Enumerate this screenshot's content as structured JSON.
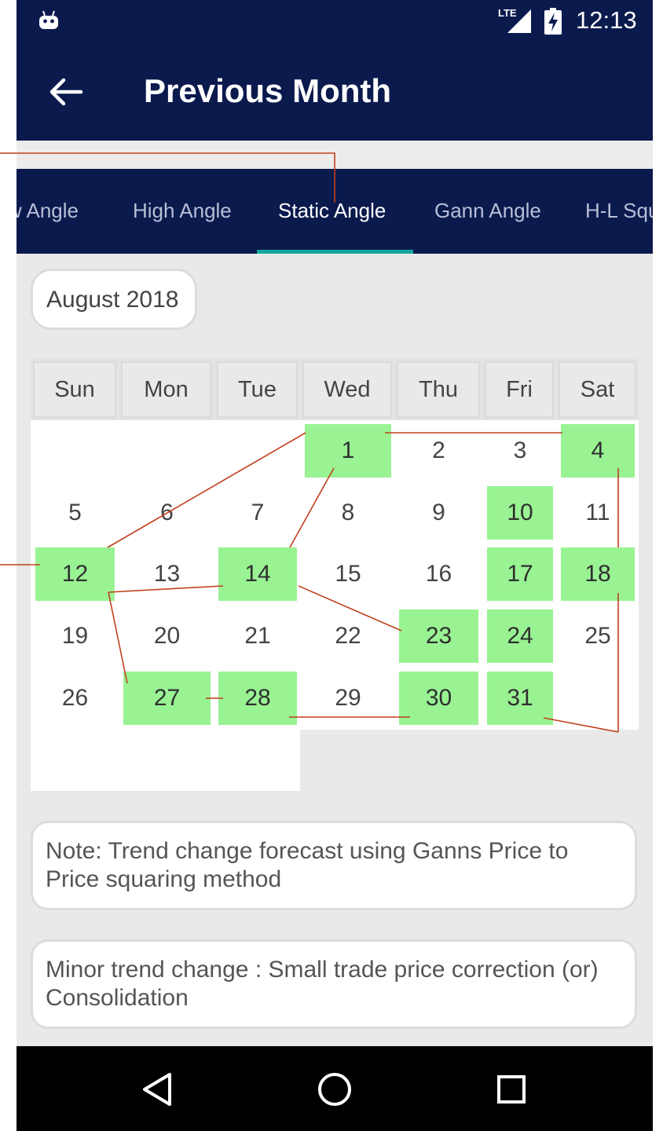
{
  "status_bar": {
    "network": "LTE",
    "time": "12:13"
  },
  "app_bar": {
    "title": "Previous Month",
    "back_icon": "arrow-left-icon"
  },
  "tabs": [
    {
      "label": "Low Angle",
      "active": false
    },
    {
      "label": "High Angle",
      "active": false
    },
    {
      "label": "Static Angle",
      "active": true
    },
    {
      "label": "Gann Angle",
      "active": false
    },
    {
      "label": "H-L Square",
      "active": false
    }
  ],
  "month_label": "August 2018",
  "calendar": {
    "weekdays": [
      "Sun",
      "Mon",
      "Tue",
      "Wed",
      "Thu",
      "Fri",
      "Sat"
    ],
    "weeks": [
      [
        "",
        "",
        "",
        "1",
        "2",
        "3",
        "4"
      ],
      [
        "5",
        "6",
        "7",
        "8",
        "9",
        "10",
        "11"
      ],
      [
        "12",
        "13",
        "14",
        "15",
        "16",
        "17",
        "18"
      ],
      [
        "19",
        "20",
        "21",
        "22",
        "23",
        "24",
        "25"
      ],
      [
        "26",
        "27",
        "28",
        "29",
        "30",
        "31",
        ""
      ]
    ],
    "highlighted_days": [
      "1",
      "4",
      "10",
      "12",
      "14",
      "17",
      "18",
      "23",
      "24",
      "27",
      "28",
      "30",
      "31"
    ],
    "highlight_color": "#99f393",
    "trend_line_color": "#c0401a"
  },
  "notes": [
    "Note: Trend change forecast using Ganns Price to Price squaring method",
    "Minor trend change : Small trade price correction (or) Consolidation"
  ],
  "nav_bar": {
    "back_icon": "triangle-back-icon",
    "home_icon": "circle-home-icon",
    "recents_icon": "square-recents-icon"
  },
  "colors": {
    "primary_dark": "#0b1a4d",
    "tab_indicator": "#14a79a",
    "background": "#e9e9e9"
  }
}
